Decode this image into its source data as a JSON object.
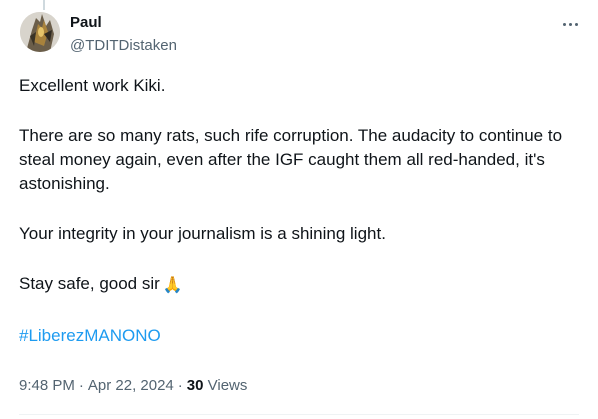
{
  "author": {
    "display_name": "Paul",
    "handle": "@TDITDistaken"
  },
  "tweet": {
    "paragraphs": [
      "Excellent work Kiki.",
      "There are so many rats, such rife corruption. The audacity to continue to steal money again, even after the IGF caught them all red-handed, it's astonishing.",
      "Your integrity in your journalism is a shining light."
    ],
    "closing_text": "Stay safe, good sir",
    "closing_emoji": "🙏",
    "hashtag": "#LiberezMANONO"
  },
  "meta": {
    "time": "9:48 PM",
    "separator": "·",
    "date": "Apr 22, 2024",
    "views_count": "30",
    "views_label": "Views"
  },
  "icons": {
    "more": "more-horizontal-icon",
    "pray": "folded-hands-emoji"
  },
  "colors": {
    "text": "#0f1419",
    "secondary": "#536471",
    "link": "#1d9bf0"
  }
}
